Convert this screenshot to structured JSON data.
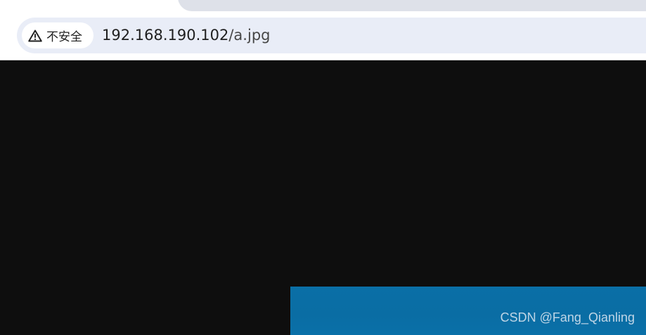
{
  "address_bar": {
    "security_label": "不安全",
    "security_icon": "warning-triangle-icon",
    "url_host": "192.168.190.102",
    "url_path": "/a.jpg"
  },
  "viewer": {
    "background_color": "#0e0e0e",
    "image_color": "#0a6fa6",
    "watermark_text": "CSDN @Fang_Qianling"
  }
}
